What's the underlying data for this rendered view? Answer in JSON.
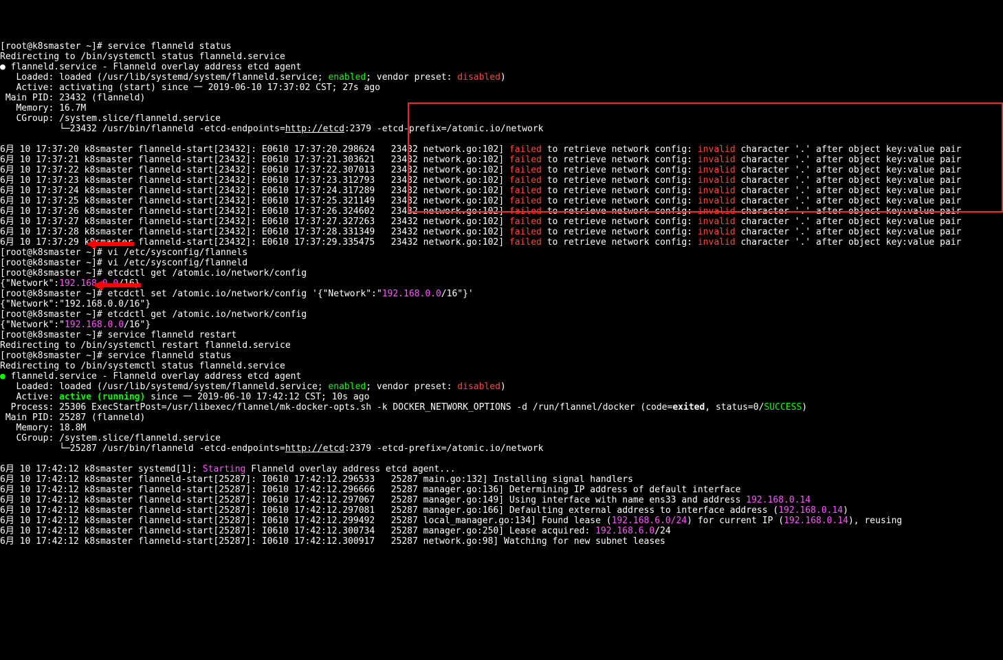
{
  "lines": {
    "l0": "[root@k8smaster ~]# service flanneld status",
    "l1": "Redirecting to /bin/systemctl status flanneld.service",
    "l2a": "● ",
    "l2b": "flanneld.service - Flanneld overlay address etcd agent",
    "l3a": "   Loaded: loaded (/usr/lib/systemd/system/flanneld.service; ",
    "l3b": "enabled",
    "l3c": "; vendor preset: ",
    "l3d": "disabled",
    "l3e": ")",
    "l4": "   Active: activating (start) since 一 2019-06-10 17:37:02 CST; 27s ago",
    "l5": " Main PID: 23432 (flanneld)",
    "l6": "   Memory: 16.7M",
    "l7": "   CGroup: /system.slice/flanneld.service",
    "l8a": "           └─23432 /usr/bin/flanneld -etcd-endpoints=",
    "l8url": "http://etcd",
    "l8b": ":2379 -etcd-prefix=/atomic.io/network",
    "blank": "",
    "f_pre": "6月 10 17:37:",
    "f_mid": " k8smaster flanneld-start[23432]: E0610 17:37:",
    "f_tail_a": "   23432 network.go:102] ",
    "f_failed": "failed",
    "f_to": " to retrieve network config: ",
    "f_invalid": "invalid",
    "f_rest": " character '.' after object key:value pair",
    "fl": [
      {
        "t1": "20",
        "t2": "20.298624"
      },
      {
        "t1": "21",
        "t2": "21.303621"
      },
      {
        "t1": "22",
        "t2": "22.307013"
      },
      {
        "t1": "23",
        "t2": "23.312793"
      },
      {
        "t1": "24",
        "t2": "24.317289"
      },
      {
        "t1": "25",
        "t2": "25.321149"
      },
      {
        "t1": "26",
        "t2": "26.324602"
      },
      {
        "t1": "27",
        "t2": "27.327263"
      },
      {
        "t1": "28",
        "t2": "28.331349"
      },
      {
        "t1": "29",
        "t2": "29.335475"
      }
    ],
    "c0": "[root@k8smaster ~]# vi /etc/sysconfig/flannels",
    "c1": "[root@k8smaster ~]# vi /etc/sysconfig/flanneld",
    "c2": "[root@k8smaster ~]# etcdctl get /atomic.io/network/config",
    "c3a": "{\"Network\":",
    "c3b": "192.168.0.0",
    "c3c": "/16}",
    "c4a": "[root@k8smaster ~]# etcdctl set /atomic.io/network/config '{\"Network\":\"",
    "c4b": "192.168.0.0",
    "c4c": "/16\"}'",
    "c5": "{\"Network\":\"192.168.0.0/16\"}",
    "c6": "[root@k8smaster ~]# etcdctl get /atomic.io/network/config",
    "c7a": "{\"Network\":\"",
    "c7b": "192.168.0.0",
    "c7c": "/16\"}",
    "c8": "[root@k8smaster ~]# service flanneld restart",
    "c9": "Redirecting to /bin/systemctl restart flanneld.service",
    "c10": "[root@k8smaster ~]# service flanneld status",
    "c11": "Redirecting to /bin/systemctl status flanneld.service",
    "s0a": "● ",
    "s0b": "flanneld.service - Flanneld overlay address etcd agent",
    "s1a": "   Loaded: loaded (/usr/lib/systemd/system/flanneld.service; ",
    "s1b": "enabled",
    "s1c": "; vendor preset: ",
    "s1d": "disabled",
    "s1e": ")",
    "s2a": "   Active: ",
    "s2b": "active (running)",
    "s2c": " since 一 2019-06-10 17:42:12 CST; 10s ago",
    "s3a": "  Process: 25306 ExecStartPost=/usr/libexec/flannel/mk-docker-opts.sh -k DOCKER_NETWORK_OPTIONS -d /run/flannel/docker (code=",
    "s3b": "exited",
    "s3c": ", status=0/",
    "s3d": "SUCCESS",
    "s3e": ")",
    "s4": " Main PID: 25287 (flanneld)",
    "s5": "   Memory: 18.8M",
    "s6": "   CGroup: /system.slice/flanneld.service",
    "s7a": "           └─25287 /usr/bin/flanneld -etcd-endpoints=",
    "s7url": "http://etcd",
    "s7b": ":2379 -etcd-prefix=/atomic.io/network",
    "j0a": "6月 10 17:42:12 k8smaster systemd[1]: ",
    "j0b": "Starting",
    "j0c": " Flanneld overlay address etcd agent...",
    "j1": "6月 10 17:42:12 k8smaster flanneld-start[25287]: I0610 17:42:12.296533   25287 main.go:132] Installing signal handlers",
    "j2": "6月 10 17:42:12 k8smaster flanneld-start[25287]: I0610 17:42:12.296666   25287 manager.go:136] Determining IP address of default interface",
    "j3a": "6月 10 17:42:12 k8smaster flanneld-start[25287]: I0610 17:42:12.297067   25287 manager.go:149] Using interface with name ens33 and address ",
    "j3b": "192.168.0.14",
    "j4a": "6月 10 17:42:12 k8smaster flanneld-start[25287]: I0610 17:42:12.297081   25287 manager.go:166] Defaulting external address to interface address (",
    "j4b": "192.168.0.14",
    "j4c": ")",
    "j5a": "6月 10 17:42:12 k8smaster flanneld-start[25287]: I0610 17:42:12.299492   25287 local_manager.go:134] Found lease (",
    "j5b": "192.168.6.0/24",
    "j5c": ") for current IP (",
    "j5d": "192.168.0.14",
    "j5e": "), reusing",
    "j6a": "6月 10 17:42:12 k8smaster flanneld-start[25287]: I0610 17:42:12.300734   25287 manager.go:250] Lease acquired: ",
    "j6b": "192.168.6.0",
    "j6c": "/24",
    "j7": "6月 10 17:42:12 k8smaster flanneld-start[25287]: I0610 17:42:12.300917   25287 network.go:98] Watching for new subnet leases"
  }
}
